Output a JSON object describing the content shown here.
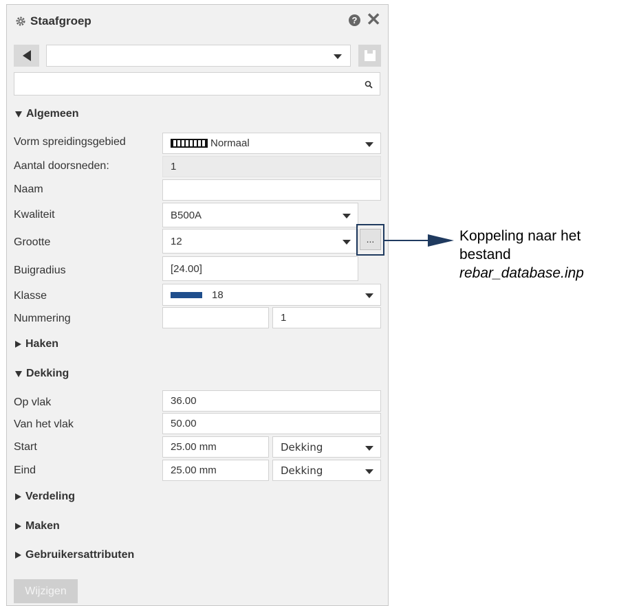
{
  "panel": {
    "title": "Staafgroep",
    "help_label": "?",
    "close_label": "✕"
  },
  "top": {
    "preset_value": "",
    "search_value": ""
  },
  "sections": {
    "algemeen": "Algemeen",
    "haken": "Haken",
    "dekking": "Dekking",
    "verdeling": "Verdeling",
    "maken": "Maken",
    "gebruikersattributen": "Gebruikersattributen"
  },
  "algemeen": {
    "vorm_label": "Vorm spreidingsgebied",
    "vorm_value": "Normaal",
    "aantal_label": "Aantal doorsneden:",
    "aantal_value": "1",
    "naam_label": "Naam",
    "naam_value": "",
    "kwaliteit_label": "Kwaliteit",
    "kwaliteit_value": "B500A",
    "grootte_label": "Grootte",
    "grootte_value": "12",
    "ellipsis_label": "...",
    "buigradius_label": "Buigradius",
    "buigradius_value": "[24.00]",
    "klasse_label": "Klasse",
    "klasse_value": "18",
    "klasse_color": "#1f4e8c",
    "nummering_label": "Nummering",
    "nummering_prefix": "",
    "nummering_value": "1"
  },
  "dekking": {
    "op_vlak_label": "Op vlak",
    "op_vlak_value": "36.00",
    "van_vlak_label": "Van het vlak",
    "van_vlak_value": "50.00",
    "start_label": "Start",
    "start_value": "25.00 mm",
    "start_type": "Dekking",
    "eind_label": "Eind",
    "eind_value": "25.00 mm",
    "eind_type": "Dekking"
  },
  "buttons": {
    "wijzigen": "Wijzigen"
  },
  "callout": {
    "line1": "Koppeling naar het",
    "line2": "bestand",
    "line3": "rebar_database.inp",
    "color": "#1f3a5f"
  }
}
